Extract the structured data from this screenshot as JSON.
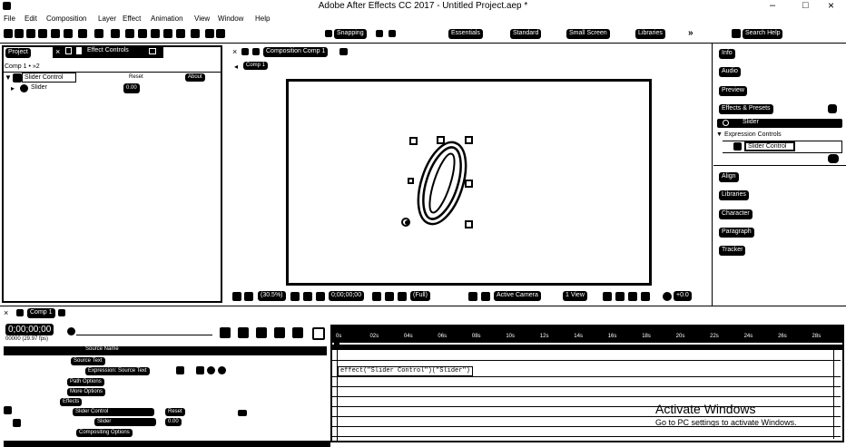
{
  "window": {
    "title": "Adobe After Effects CC 2017 - Untitled Project.aep *",
    "controls": [
      "–",
      "□",
      "×"
    ]
  },
  "menu": [
    "File",
    "Edit",
    "Composition",
    "Layer",
    "Effect",
    "Animation",
    "View",
    "Window",
    "Help"
  ],
  "toolbar": {
    "snapping": "Snapping",
    "workspaces": [
      "Essentials",
      "Standard",
      "Small Screen",
      "Libraries"
    ],
    "search": "Search Help"
  },
  "left_panel": {
    "tabs": [
      "Project",
      "Effect Controls"
    ],
    "effect_controls_target": "Comp 1 • »2",
    "effect_name": "Slider Control",
    "reset": "Reset",
    "about": "About",
    "param": "Slider",
    "param_value": "0.00"
  },
  "composition": {
    "tab": "Composition Comp 1",
    "sub_tab": "Comp 1",
    "glyph": "0",
    "footer": {
      "zoom": "(30.5%)",
      "timecode": "0;00;00;00",
      "resolution": "(Full)",
      "camera": "Active Camera",
      "views": "1 View",
      "offset": "+0.0"
    }
  },
  "right_panel": {
    "sections": [
      "Info",
      "Audio",
      "Preview",
      "Effects & Presets",
      "Align",
      "Libraries",
      "Character",
      "Paragraph",
      "Tracker"
    ],
    "effects_search": "Slider",
    "expression_folder": "Expression Controls",
    "effect_item": "Slider Control"
  },
  "timeline": {
    "tab": "Comp 1",
    "timecode": "0;00;00;00",
    "fps": "00000 (29.97 fps)",
    "header_name": "Source Name",
    "rows": [
      {
        "label": "Source Text",
        "value": ""
      },
      {
        "label": "Expression: Source Text",
        "value": ""
      },
      {
        "label": "Path Options",
        "value": ""
      },
      {
        "label": "More Options",
        "value": ""
      },
      {
        "label": "Effects",
        "value": ""
      },
      {
        "label": "Slider Control",
        "value": "Reset"
      },
      {
        "label": "Slider",
        "value": "0.00"
      },
      {
        "label": "Compositing Options",
        "value": ""
      }
    ],
    "ruler": [
      "0s",
      "02s",
      "04s",
      "06s",
      "08s",
      "10s",
      "12s",
      "14s",
      "16s",
      "18s",
      "20s",
      "22s",
      "24s",
      "26s",
      "28s"
    ],
    "expression": "effect(\"Slider Control\")(\"Slider\")"
  },
  "watermark": {
    "title": "Activate Windows",
    "subtitle": "Go to PC settings to activate Windows."
  }
}
